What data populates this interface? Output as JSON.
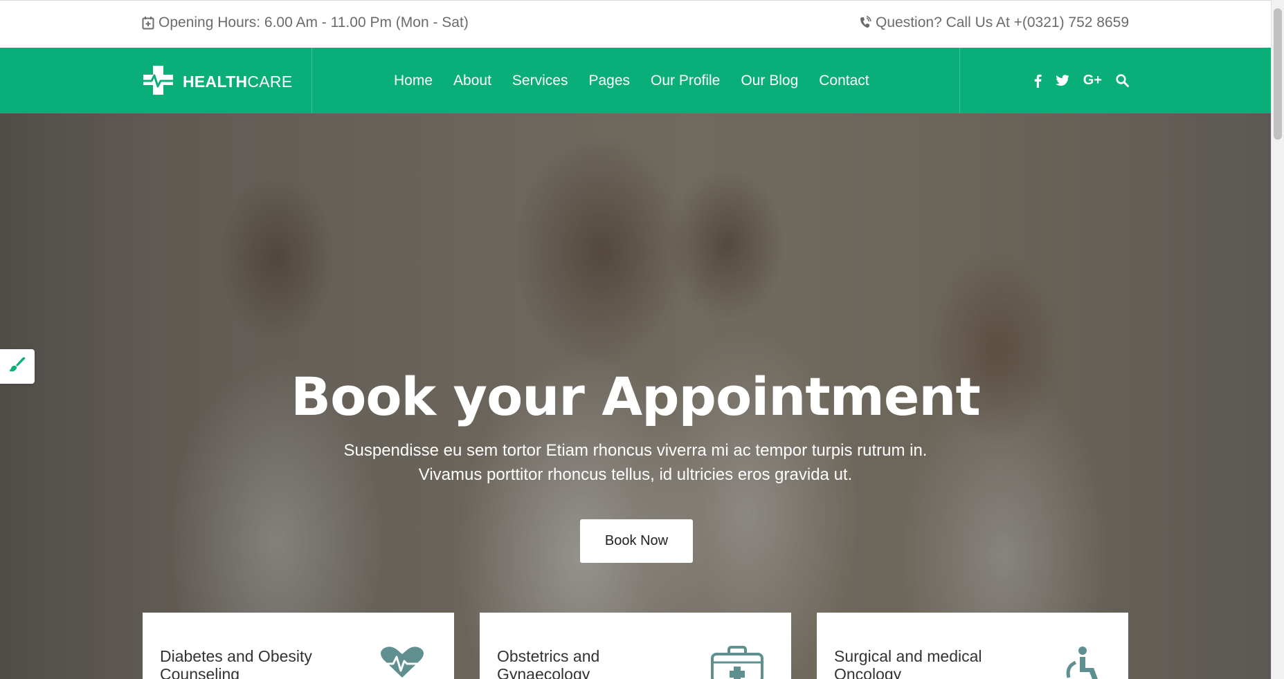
{
  "topbar": {
    "opening_hours": "Opening Hours: 6.00 Am - 11.00 Pm (Mon - Sat)",
    "phone": "Question? Call Us At +(0321) 752 8659",
    "calendar_icon": "calendar-plus-icon",
    "phone_icon": "phone-volume-icon"
  },
  "brand": {
    "bold": "HEALTH",
    "regular": "CARE",
    "logo_icon": "medical-cross-icon"
  },
  "nav": {
    "items": [
      {
        "label": "Home"
      },
      {
        "label": "About"
      },
      {
        "label": "Services"
      },
      {
        "label": "Pages"
      },
      {
        "label": "Our Profile"
      },
      {
        "label": "Our Blog"
      },
      {
        "label": "Contact"
      }
    ],
    "social": {
      "facebook": "f",
      "google_plus": "G+"
    }
  },
  "hero": {
    "title": "Book your Appointment",
    "subtitle_line1": "Suspendisse eu sem tortor Etiam rhoncus viverra mi ac tempor turpis rutrum in.",
    "subtitle_line2": "Vivamus porttitor rhoncus tellus, id ultricies eros gravida ut.",
    "button": "Book Now"
  },
  "cards": [
    {
      "title_line1": "Diabetes and Obesity",
      "title_line2": "Counseling",
      "icon": "heart-pulse-icon"
    },
    {
      "title_line1": "Obstetrics and",
      "title_line2": "Gynaecology",
      "icon": "medical-kit-icon"
    },
    {
      "title_line1": "Surgical and medical",
      "title_line2": "Oncology",
      "icon": "wheelchair-icon"
    }
  ],
  "colors": {
    "brand_green": "#0aae79",
    "icon_teal": "#5f8f8f"
  }
}
